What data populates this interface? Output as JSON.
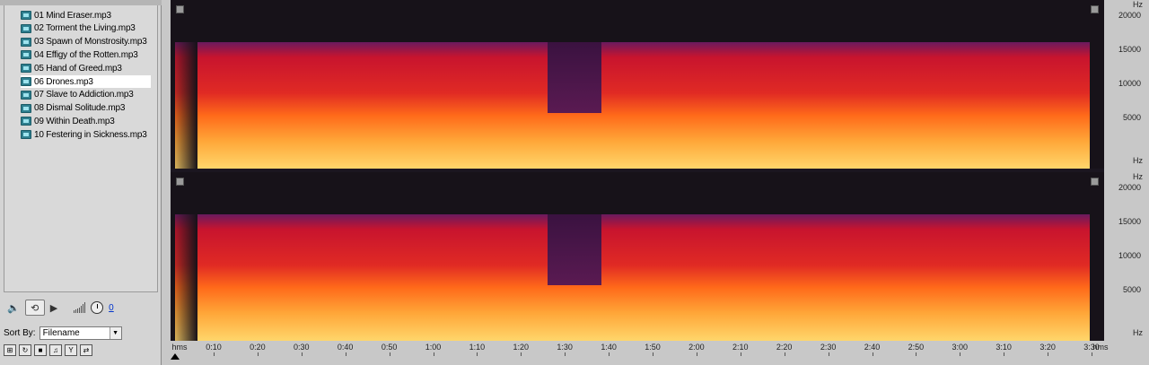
{
  "files": [
    {
      "name": "01 Mind Eraser.mp3",
      "selected": false
    },
    {
      "name": "02 Torment the Living.mp3",
      "selected": false
    },
    {
      "name": "03 Spawn of Monstrosity.mp3",
      "selected": false
    },
    {
      "name": "04 Effigy of the Rotten.mp3",
      "selected": false
    },
    {
      "name": "05 Hand of Greed.mp3",
      "selected": false
    },
    {
      "name": "06 Drones.mp3",
      "selected": true
    },
    {
      "name": "07 Slave to Addiction.mp3",
      "selected": false
    },
    {
      "name": "08 Dismal Solitude.mp3",
      "selected": false
    },
    {
      "name": "09 Within Death.mp3",
      "selected": false
    },
    {
      "name": "10 Festering in Sickness.mp3",
      "selected": false
    }
  ],
  "transport": {
    "speaker_icon": "speaker-icon",
    "loop_icon": "loop-icon",
    "play_icon": "play-icon",
    "volume_value": "0"
  },
  "sort": {
    "label": "Sort By:",
    "value": "Filename"
  },
  "spectrogram": {
    "hz_unit": "Hz",
    "hz_ticks": [
      "20000",
      "15000",
      "10000",
      "5000"
    ],
    "time_unit": "hms",
    "time_labels": [
      "0:10",
      "0:20",
      "0:30",
      "0:40",
      "0:50",
      "1:00",
      "1:10",
      "1:20",
      "1:30",
      "1:40",
      "1:50",
      "2:00",
      "2:10",
      "2:20",
      "2:30",
      "2:40",
      "2:50",
      "3:00",
      "3:10",
      "3:20",
      "3:30"
    ],
    "colors": {
      "background": "#171219",
      "low": "#ffd66b",
      "mid": "#ff6a1a",
      "high": "#c8142e",
      "top": "#6a1a5e"
    }
  }
}
